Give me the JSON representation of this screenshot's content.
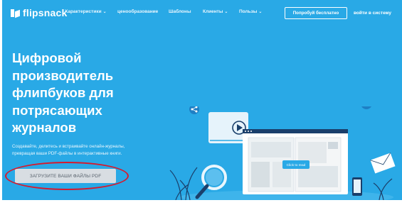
{
  "brand": {
    "name": "flipsnack"
  },
  "nav": {
    "items": [
      {
        "label": "Характеристики",
        "dropdown": true
      },
      {
        "label": "ценообразование",
        "dropdown": false
      },
      {
        "label": "Шаблоны",
        "dropdown": false
      },
      {
        "label": "Клиенты",
        "dropdown": true
      },
      {
        "label": "Пользы",
        "dropdown": true
      }
    ],
    "try_free": "Попробуй бесплатно",
    "sign_in": "войти в систему"
  },
  "hero": {
    "title_lines": [
      "Цифровой",
      "производитель",
      "флипбуков для",
      "потрясающих",
      "журналов"
    ],
    "subtitle_lines": [
      "Создавайте, делитесь и встраивайте онлайн-журналы,",
      "превращая ваши PDF-файлы в интерактивные книги."
    ],
    "upload_button": "ЗАГРУЗИТЕ ВАШИ ФАЙЛЫ PDF"
  },
  "illustration": {
    "click_to_read": "Click to read"
  },
  "colors": {
    "background": "#29a9e6",
    "annotation": "#d7192c",
    "button": "#d8dde2"
  }
}
